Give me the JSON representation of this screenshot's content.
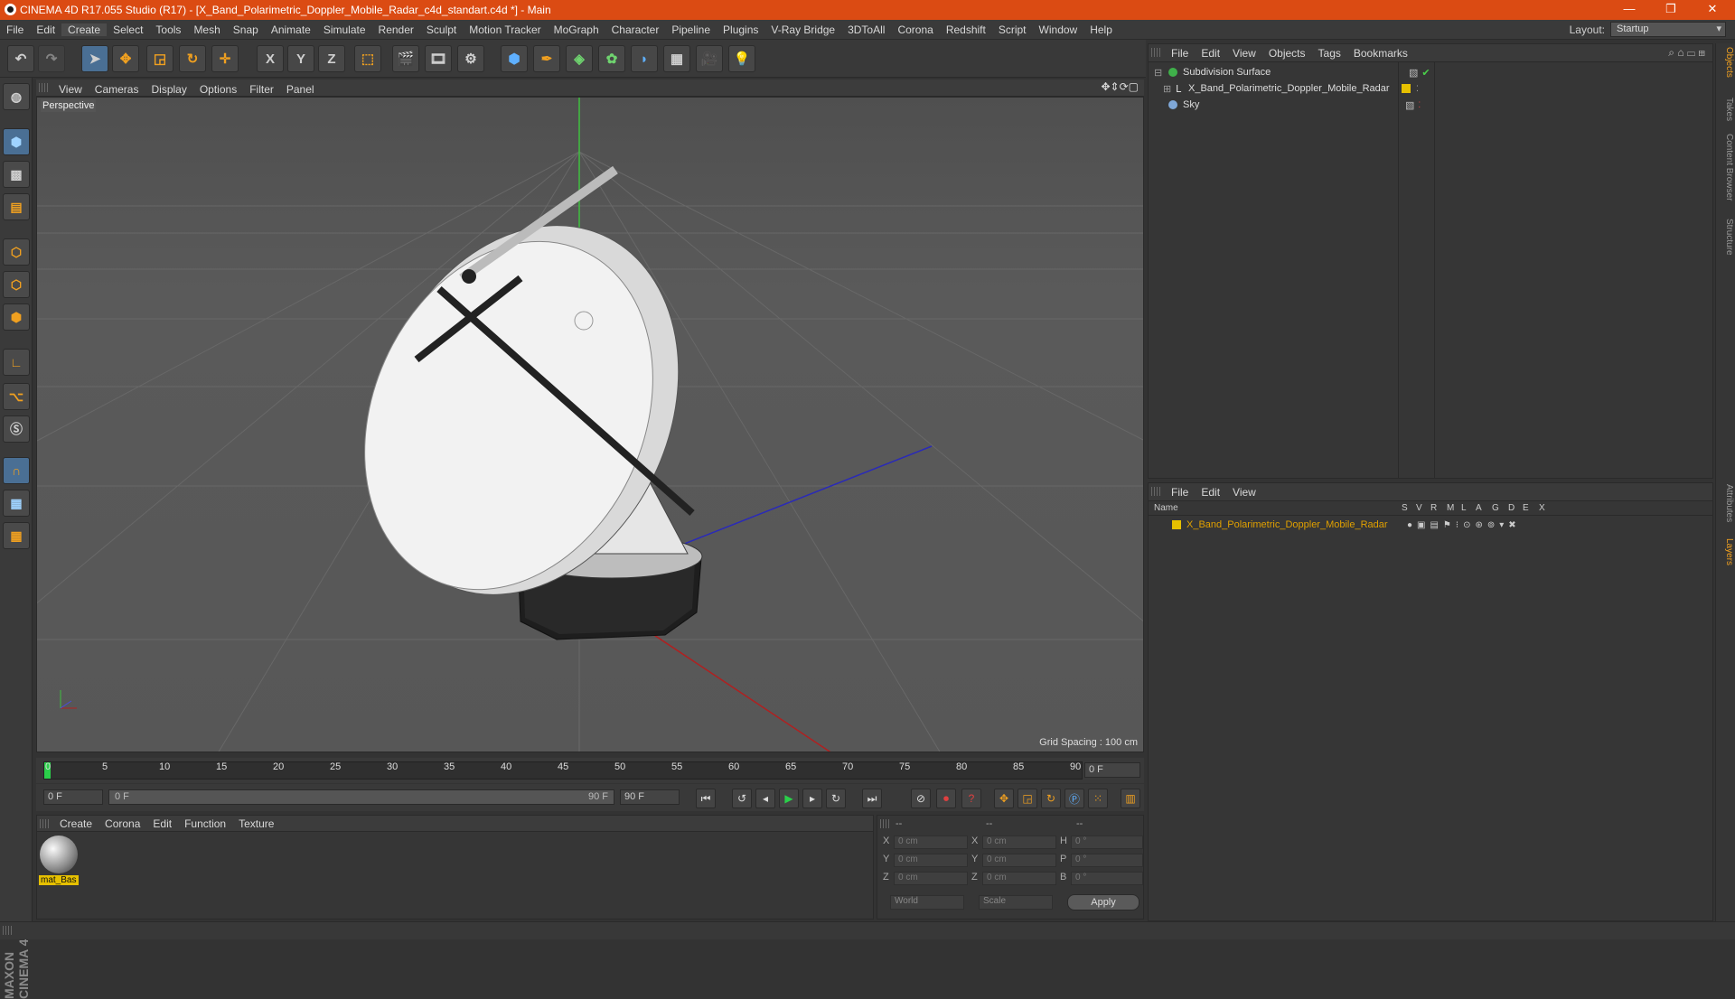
{
  "window": {
    "title": "CINEMA 4D R17.055 Studio (R17) - [X_Band_Polarimetric_Doppler_Mobile_Radar_c4d_standart.c4d *] - Main",
    "minimize": "—",
    "restore": "❐",
    "close": "✕"
  },
  "menubar": {
    "items": [
      "File",
      "Edit",
      "Create",
      "Select",
      "Tools",
      "Mesh",
      "Snap",
      "Animate",
      "Simulate",
      "Render",
      "Sculpt",
      "Motion Tracker",
      "MoGraph",
      "Character",
      "Pipeline",
      "Plugins",
      "V-Ray Bridge",
      "3DToAll",
      "Corona",
      "Redshift",
      "Script",
      "Window",
      "Help"
    ],
    "layout_label": "Layout:",
    "layout_value": "Startup"
  },
  "toolbar": {
    "axis_x": "X",
    "axis_y": "Y",
    "axis_z": "Z"
  },
  "viewport": {
    "menu": [
      "View",
      "Cameras",
      "Display",
      "Options",
      "Filter",
      "Panel"
    ],
    "camera_label": "Perspective",
    "grid_spacing": "Grid Spacing : 100 cm"
  },
  "timeline": {
    "ticks": [
      "0",
      "5",
      "10",
      "15",
      "20",
      "25",
      "30",
      "35",
      "40",
      "45",
      "50",
      "55",
      "60",
      "65",
      "70",
      "75",
      "80",
      "85",
      "90"
    ],
    "end_frame_field": "0 F",
    "current_frame": "0 F",
    "range_start": "0 F",
    "range_end_inner": "90 F",
    "range_end": "90 F"
  },
  "material_manager": {
    "menu": [
      "Create",
      "Corona",
      "Edit",
      "Function",
      "Texture"
    ],
    "materials": [
      {
        "name": "mat_Bas"
      }
    ]
  },
  "coordinates": {
    "header": [
      "--",
      "--",
      "--"
    ],
    "rows": [
      {
        "l1": "X",
        "v1": "0 cm",
        "l2": "X",
        "v2": "0 cm",
        "l3": "H",
        "v3": "0 °"
      },
      {
        "l1": "Y",
        "v1": "0 cm",
        "l2": "Y",
        "v2": "0 cm",
        "l3": "P",
        "v3": "0 °"
      },
      {
        "l1": "Z",
        "v1": "0 cm",
        "l2": "Z",
        "v2": "0 cm",
        "l3": "B",
        "v3": "0 °"
      }
    ],
    "space": "World",
    "mode": "Scale",
    "apply": "Apply"
  },
  "object_manager": {
    "menu": [
      "File",
      "Edit",
      "View",
      "Objects",
      "Tags",
      "Bookmarks"
    ],
    "objects": [
      {
        "name": "Subdivision Surface"
      },
      {
        "name": "X_Band_Polarimetric_Doppler_Mobile_Radar"
      },
      {
        "name": "Sky"
      }
    ]
  },
  "layer_manager": {
    "menu": [
      "File",
      "Edit",
      "View"
    ],
    "columns": [
      "Name",
      "S",
      "V",
      "R",
      "M",
      "L",
      "A",
      "G",
      "D",
      "E",
      "X"
    ],
    "layers": [
      {
        "name": "X_Band_Polarimetric_Doppler_Mobile_Radar",
        "color": "#e6c000"
      }
    ]
  },
  "right_tabs": [
    "Objects",
    "Takes",
    "Content Browser",
    "Structure",
    "Attributes",
    "Layers"
  ],
  "branding": "MAXON CINEMA 4D",
  "colors": {
    "title_bar": "#db4b13",
    "layer_text": "#e0a000",
    "highlight_blue": "#4a6f94"
  }
}
